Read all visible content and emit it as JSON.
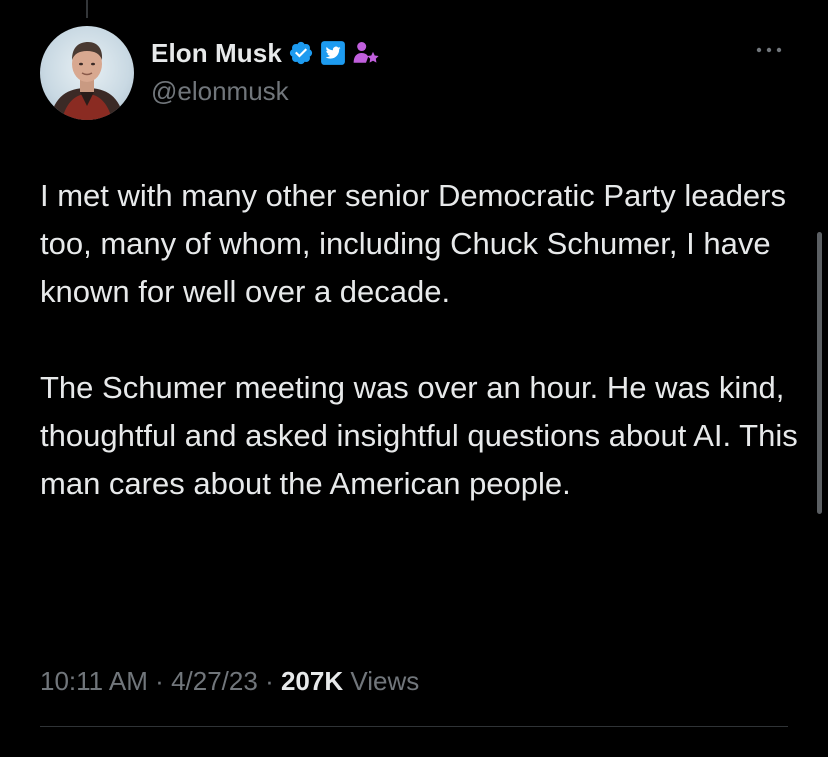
{
  "author": {
    "display_name": "Elon Musk",
    "handle": "@elonmusk",
    "avatar_icon": "profile-photo",
    "badges": [
      {
        "icon": "verified-badge-icon",
        "color": "#1d9bf0"
      },
      {
        "icon": "twitter-bird-affiliate-icon",
        "color": "#1d9bf0"
      },
      {
        "icon": "person-star-icon",
        "color": "#c05fdc"
      }
    ]
  },
  "menu": {
    "more_label": "···"
  },
  "tweet": {
    "paragraphs": [
      "I met with many other senior Democratic Party leaders too, many of whom, including Chuck Schumer, I have known for well over a decade.",
      "The Schumer meeting was over an hour. He was kind, thoughtful and asked insightful questions about AI. This man cares about the American people."
    ],
    "time": "10:11 AM",
    "separator": "·",
    "date": "4/27/23",
    "views_count": "207K",
    "views_label": "Views"
  },
  "colors": {
    "background": "#000000",
    "primary_text": "#e7e9ea",
    "secondary_text": "#71767b",
    "accent_blue": "#1d9bf0"
  }
}
